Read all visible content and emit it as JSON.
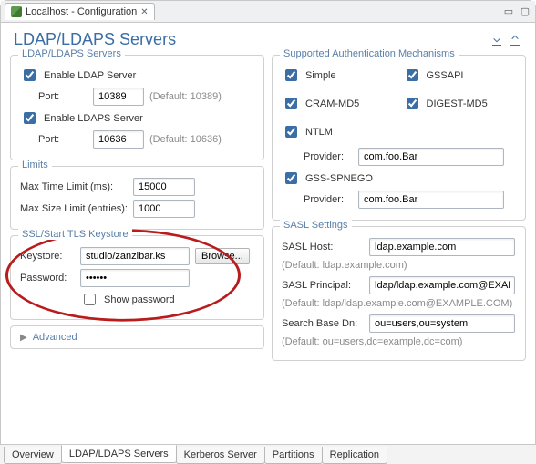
{
  "header": {
    "tab_title": "Localhost - Configuration"
  },
  "title": "LDAP/LDAPS Servers",
  "ldap_servers": {
    "legend": "LDAP/LDAPS Servers",
    "enable_ldap_label": "Enable LDAP Server",
    "port_label": "Port:",
    "ldap_port": "10389",
    "ldap_port_hint": "(Default: 10389)",
    "enable_ldaps_label": "Enable LDAPS Server",
    "ldaps_port": "10636",
    "ldaps_port_hint": "(Default: 10636)"
  },
  "limits": {
    "legend": "Limits",
    "time_label": "Max Time Limit (ms):",
    "time_value": "15000",
    "size_label": "Max Size Limit (entries):",
    "size_value": "1000"
  },
  "ssl": {
    "legend": "SSL/Start TLS Keystore",
    "keystore_label": "Keystore:",
    "keystore_value": "studio/zanzibar.ks",
    "browse_label": "Browse...",
    "password_label": "Password:",
    "password_value": "••••••",
    "show_password_label": "Show password"
  },
  "advanced_label": "Advanced",
  "auth": {
    "legend": "Supported Authentication Mechanisms",
    "simple": "Simple",
    "gssapi": "GSSAPI",
    "cram": "CRAM-MD5",
    "digest": "DIGEST-MD5",
    "ntlm": "NTLM",
    "provider_label": "Provider:",
    "provider1": "com.foo.Bar",
    "gssspnego": "GSS-SPNEGO",
    "provider2": "com.foo.Bar"
  },
  "sasl": {
    "legend": "SASL Settings",
    "host_label": "SASL Host:",
    "host_value": "ldap.example.com",
    "host_hint": "(Default: ldap.example.com)",
    "principal_label": "SASL Principal:",
    "principal_value": "ldap/ldap.example.com@EXAMPLE",
    "principal_hint": "(Default: ldap/ldap.example.com@EXAMPLE.COM)",
    "basedn_label": "Search Base Dn:",
    "basedn_value": "ou=users,ou=system",
    "basedn_hint": "(Default: ou=users,dc=example,dc=com)"
  },
  "bottom_tabs": {
    "overview": "Overview",
    "ldap": "LDAP/LDAPS Servers",
    "kerberos": "Kerberos Server",
    "partitions": "Partitions",
    "replication": "Replication"
  }
}
